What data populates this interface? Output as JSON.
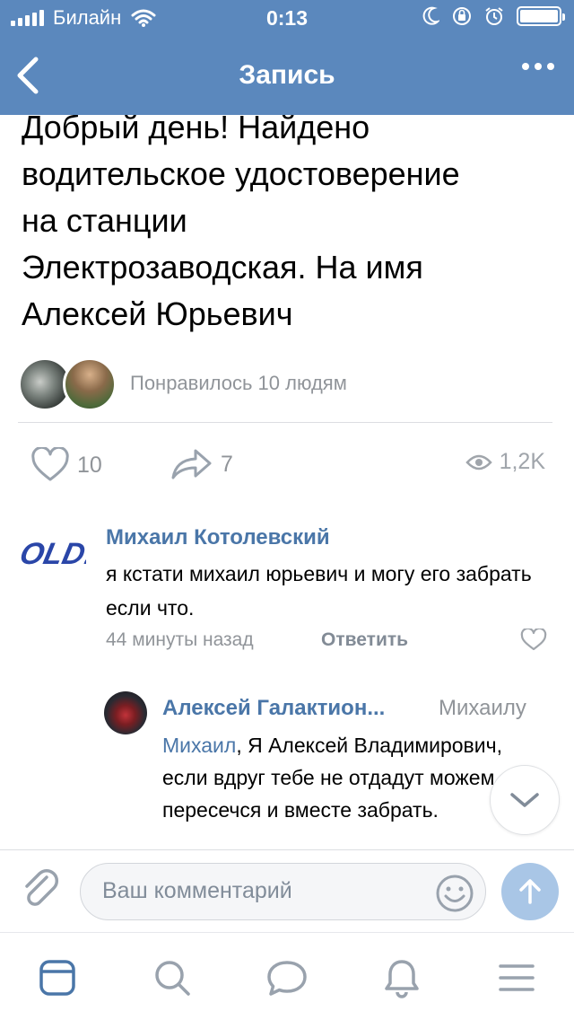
{
  "status_bar": {
    "carrier": "Билайн",
    "time": "0:13"
  },
  "nav": {
    "title": "Запись"
  },
  "post": {
    "text_lines": [
      "Добрый день! Найдено",
      "водительское удостоверение",
      "на станции",
      "Электрозаводская. На имя",
      "Алексей Юрьевич"
    ],
    "liked_by_text": "Понравилось 10 людям",
    "like_count": "10",
    "share_count": "7",
    "views": "1,2K"
  },
  "comment": {
    "author": "Михаил Котолевский",
    "avatar_text": "OLD!",
    "text": "я кстати михаил юрьевич и могу его забрать если что.",
    "time": "44 минуты назад",
    "reply_label": "Ответить"
  },
  "reply": {
    "author": "Алексей Галактион...",
    "reply_to": "Михаилу",
    "mention": "Михаил",
    "text": ", Я Алексей Владимирович, если вдруг тебе не отдадут можем пересечся и вместе забрать."
  },
  "composer": {
    "placeholder": "Ваш комментарий"
  },
  "colors": {
    "header": "#5b88bd",
    "link": "#4a76a8",
    "secondary_text": "#909499",
    "send_button": "#a9c6e6"
  },
  "icons": {
    "back": "chevron-left-icon",
    "more": "more-dots-icon",
    "like": "heart-icon",
    "share": "share-arrow-icon",
    "views": "eye-icon",
    "attach": "paperclip-icon",
    "emoji": "smile-icon",
    "send": "arrow-up-icon",
    "scroll": "chevron-down-icon",
    "tabs": [
      "news-icon",
      "search-icon",
      "messages-icon",
      "notifications-icon",
      "menu-icon"
    ]
  }
}
